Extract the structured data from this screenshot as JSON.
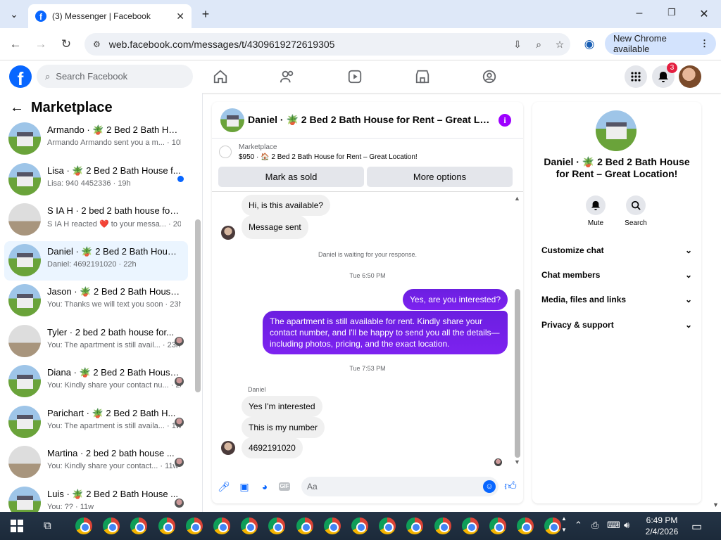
{
  "browser": {
    "tab_title": "(3) Messenger | Facebook",
    "url": "web.facebook.com/messages/t/4309619272619305",
    "new_chrome_label": "New Chrome available"
  },
  "facebook": {
    "search_placeholder": "Search Facebook",
    "notifications_count": "3"
  },
  "sidebar": {
    "title": "Marketplace",
    "conversations": [
      {
        "name": "Armando · 🪴 2 Bed 2 Bath Hou...",
        "preview": "Armando Armando sent you a m...",
        "time": "10h",
        "thumb": "house"
      },
      {
        "name": "Lisa · 🪴 2 Bed 2 Bath House f...",
        "preview": "Lisa: 940 4452336",
        "time": "19h",
        "thumb": "house",
        "unread": true
      },
      {
        "name": "S IA H · 2 bed 2 bath house for ...",
        "preview": "S IA H reacted ❤️ to your messa...",
        "time": "20h",
        "thumb": "room"
      },
      {
        "name": "Daniel · 🪴 2 Bed 2 Bath House ...",
        "preview": "Daniel: 4692191020",
        "time": "22h",
        "thumb": "house",
        "active": true
      },
      {
        "name": "Jason · 🪴 2 Bed 2 Bath House f...",
        "preview": "You: Thanks we will text you soon",
        "time": "23h",
        "thumb": "house"
      },
      {
        "name": "Tyler · 2 bed 2 bath house for...",
        "preview": "You: The apartment is still avail...",
        "time": "23h",
        "thumb": "room"
      },
      {
        "name": "Diana · 🪴 2 Bed 2 Bath House f...",
        "preview": "You: Kindly share your contact nu...",
        "time": "2d",
        "thumb": "house"
      },
      {
        "name": "Parichart · 🪴 2 Bed 2 Bath H...",
        "preview": "You: The apartment is still availa...",
        "time": "1w",
        "thumb": "house"
      },
      {
        "name": "Martina · 2 bed 2 bath house ...",
        "preview": "You: Kindly share your contact...",
        "time": "11w",
        "thumb": "room"
      },
      {
        "name": "Luis · 🪴 2 Bed 2 Bath House ...",
        "preview": "You: ??",
        "time": "11w",
        "thumb": "house"
      }
    ]
  },
  "chat": {
    "header_title": "Daniel · 🪴 2 Bed 2 Bath House for Rent – Great Locati...",
    "marketplace_label": "Marketplace",
    "listing_line": "$950 · 🏠 2 Bed 2 Bath House for Rent – Great Location!",
    "mark_sold": "Mark as sold",
    "more_options": "More options",
    "msg_available": "Hi, is this available?",
    "msg_sent": "Message sent",
    "waiting_note": "Daniel is waiting for your response.",
    "time1": "Tue 6:50 PM",
    "out1": "Yes, are you interested?",
    "out2": "The apartment is still available for rent. Kindly share your contact number, and I'll be happy to send you all the details—including photos, pricing, and the exact location.",
    "time2": "Tue 7:53 PM",
    "sender_name": "Daniel",
    "in1": "Yes I'm interested",
    "in2": "This is my number",
    "in3": "4692191020",
    "input_placeholder": "Aa"
  },
  "details": {
    "title": "Daniel · 🪴 2 Bed 2 Bath House for Rent – Great Location!",
    "mute_label": "Mute",
    "search_label": "Search",
    "sections": [
      "Customize chat",
      "Chat members",
      "Media, files and links",
      "Privacy & support"
    ]
  },
  "taskbar": {
    "time": "6:49 PM",
    "date": "2/4/2026"
  },
  "colors": {
    "accent": "#0866ff",
    "outgoing_bubble": "#7a1fe8"
  }
}
